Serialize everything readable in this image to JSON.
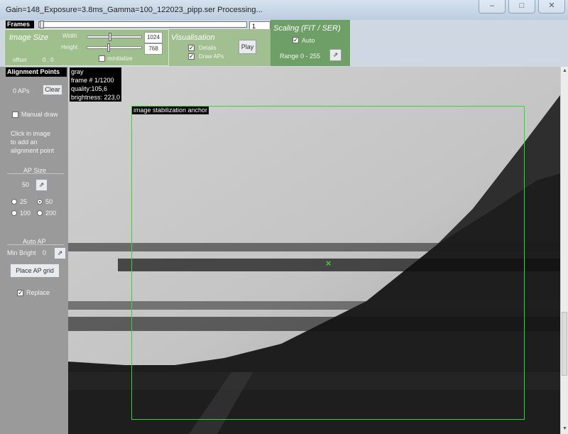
{
  "window": {
    "title": "Gain=148_Exposure=3.8ms_Gamma=100_122023_pipp.ser    Processing..."
  },
  "frames": {
    "label": "Frames",
    "value": "1"
  },
  "image_size": {
    "title": "Image Size",
    "width_label": "Width",
    "height_label": "Height",
    "width_value": "1024",
    "height_value": "768",
    "reinitialize_label": "reinitialize",
    "offset_label": "offset",
    "offset_value": "0 , 0"
  },
  "visualisation": {
    "title": "Visualisation",
    "details_label": "Details",
    "draw_aps_label": "Draw APs",
    "play_label": "Play"
  },
  "scaling": {
    "title": "Scaling (FIT / SER)",
    "auto_label": "Auto",
    "range_label": "Range 0 - 255"
  },
  "alignment_points": {
    "header": "Alignment Points",
    "aps_label": "0 APs",
    "clear_label": "Clear",
    "manual_draw_label": "Manual draw",
    "hint": [
      "Click in image",
      "to add an",
      "alignment point"
    ],
    "ap_size_label": "AP Size",
    "ap_size_value": "50",
    "sizes": [
      "25",
      "50",
      "100",
      "200"
    ],
    "selected_size": "50",
    "auto_ap_label": "Auto AP",
    "min_bright_label": "Min Bright",
    "min_bright_value": "0",
    "place_grid_label": "Place AP grid",
    "replace_label": "Replace"
  },
  "image_info": {
    "lines": [
      "gray",
      "frame # 1/1200",
      "quality:105,6",
      "brightness: 223,0"
    ],
    "anchor_label": "image stabilization anchor"
  },
  "colors": {
    "anchor_green": "#35d435",
    "panel_green": "#9fbf8d",
    "scaling_green": "#6e9f66"
  }
}
